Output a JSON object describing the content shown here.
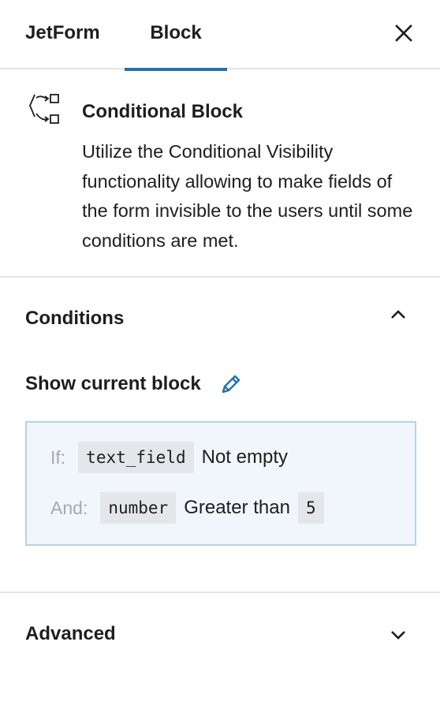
{
  "tabs": {
    "jetform_label": "JetForm",
    "block_label": "Block"
  },
  "block_card": {
    "title": "Conditional Block",
    "description": "Utilize the Conditional Visibility functionality allowing to make fields of the form invisible to the users until some conditions are met."
  },
  "conditions": {
    "title": "Conditions",
    "show_label": "Show current block",
    "rules": [
      {
        "operator": "If:",
        "field": "text_field",
        "comparison": "Not empty",
        "value": ""
      },
      {
        "operator": "And:",
        "field": "number",
        "comparison": "Greater than",
        "value": "5"
      }
    ]
  },
  "advanced": {
    "title": "Advanced"
  },
  "colors": {
    "accent": "#2271b1",
    "condition_bg": "#f0f6fc",
    "condition_border": "#b7d3e5",
    "code_bg": "#e4e7ea",
    "muted_label": "#a7aaad",
    "divider": "#e2e4e7"
  },
  "icons": [
    "close-icon",
    "conditional-block-icon",
    "chevron-up-icon",
    "pencil-icon",
    "chevron-down-icon"
  ]
}
